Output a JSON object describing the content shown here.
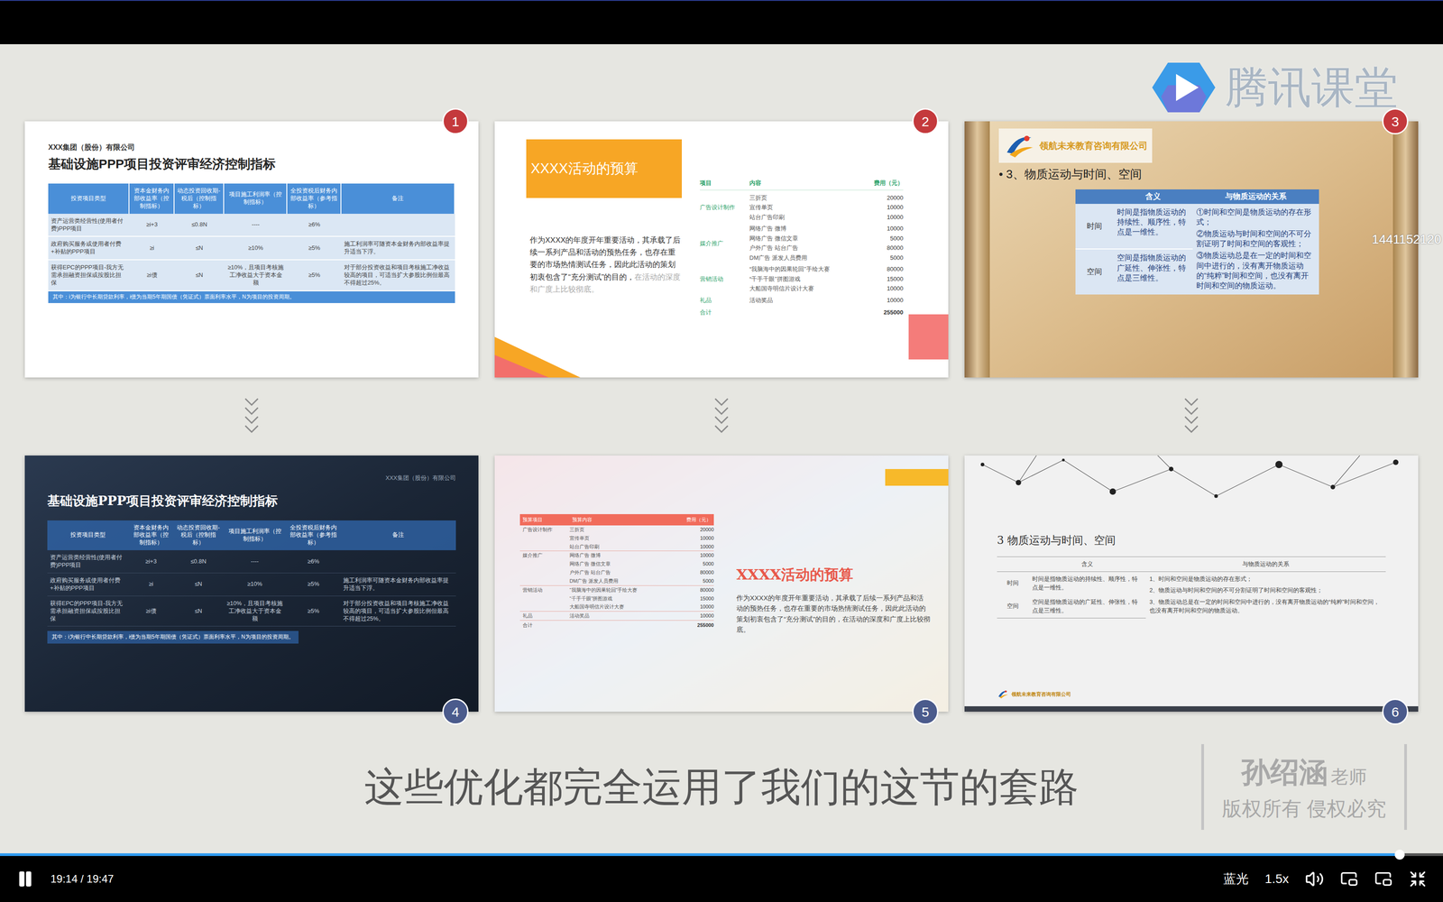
{
  "brand": {
    "name": "腾讯课堂"
  },
  "viewer_id": "1441152120",
  "ppp": {
    "company": "XXX集团（股份）有限公司",
    "title": "基础设施PPP项目投资评审经济控制指标",
    "columns": [
      "投资项目类型",
      "资本金财务内部收益率（控制指标）",
      "动态投资回收期-税后（控制指标）",
      "项目施工利润率（控制指标）",
      "全投资税后财务内部收益率（参考指标）",
      "备注"
    ],
    "rows": [
      [
        "资产运营类经营性(使用者付费)PPP项目",
        "≥i+3",
        "≤0.8N",
        "----",
        "≥6%",
        ""
      ],
      [
        "政府购买服务或使用者付费+补贴的PPP项目",
        "≥i",
        "≤N",
        "≥10%",
        "≥5%",
        "施工利润率可随资本金财务内部收益率提升适当下浮。"
      ],
      [
        "获得EPC的PPP项目-我方无需承担融资担保或按股比担保",
        "≥i债",
        "≤N",
        "≥10%，且项目考核施工净收益大于资本金额",
        "≥5%",
        "对于部分投资收益和项目考核施工净收益较高的项目，可适当扩大参股比例但最高不得超过25%。"
      ]
    ],
    "note": "其中：i为银行中长期贷款利率，i债为当期5年期国债（凭证式）票面利率水平，N为项目的投资周期。"
  },
  "budget": {
    "title": "XXXX活动的预算",
    "intro": "作为XXXX的年度开年重要活动，其承载了后续一系列产品和活动的预热任务，也存在重要的市场热情测试任务，因此此活动的策划初衷包含了“充分测试”的目的，",
    "intro_muted": "在活动的深度和广度上比较彻底。",
    "groups": [
      {
        "category": "广告设计制作",
        "items": [
          {
            "content": "三折页",
            "cost": "20000"
          },
          {
            "content": "宣传单页",
            "cost": "10000"
          },
          {
            "content": "站台广告印刷",
            "cost": "10000"
          }
        ]
      },
      {
        "category": "媒介推广",
        "items": [
          {
            "content": "网络广告 微博",
            "cost": "10000"
          },
          {
            "content": "网络广告 微信文章",
            "cost": "5000"
          },
          {
            "content": "户外广告 站台广告",
            "cost": "80000"
          },
          {
            "content": "DM广告 派发人员费用",
            "cost": "5000"
          }
        ]
      },
      {
        "category": "营销活动",
        "items": [
          {
            "content": "“我脑海中的因果轮回”手绘大赛",
            "cost": "80000"
          },
          {
            "content": "“千手千眼”拼图游戏",
            "cost": "15000"
          },
          {
            "content": "大船国寺明信片设计大赛",
            "cost": "10000"
          }
        ]
      },
      {
        "category": "礼品",
        "items": [
          {
            "content": "活动奖品",
            "cost": "10000"
          }
        ]
      }
    ],
    "total_label": "合计",
    "total": "255000"
  },
  "motion": {
    "logo": "领航未来教育咨询有限公司",
    "columns": [
      "含义",
      "与物质运动的关系"
    ],
    "rows": [
      {
        "label": "时间",
        "meaning": "时间是指物质运动的持续性、顺序性，特点是一维性。"
      },
      {
        "label": "空间",
        "meaning": "空间是指物质运动的广延性、伸张性，特点是三维性。"
      }
    ]
  },
  "thumbnails": [
    {
      "badge": "1",
      "color": "#c4393c",
      "kind": "ppp-light",
      "title": "",
      "columns": [],
      "relations": []
    },
    {
      "badge": "2",
      "color": "#c4393c",
      "kind": "budget-light",
      "title": "",
      "columns": [
        "项目",
        "内容",
        "费用（元）"
      ],
      "relations": []
    },
    {
      "badge": "3",
      "color": "#c4393c",
      "kind": "motion-scroll",
      "title": "• 3、物质运动与时间、空间",
      "columns": [],
      "relations": [
        "①时间和空间是物质运动的存在形式；",
        "②物质运动与时间和空间的不可分割证明了时间和空间的客观性；",
        "③物质运动总是在一定的时间和空间中进行的，没有离开物质运动的“纯粹”时间和空间，也没有离开时间和空间的物质运动。"
      ]
    },
    {
      "badge": "4",
      "color": "#4b5b8c",
      "kind": "ppp-dark",
      "title": "",
      "columns": [],
      "relations": []
    },
    {
      "badge": "5",
      "color": "#4b5b8c",
      "kind": "budget-photo",
      "title": "",
      "columns": [
        "预算项目",
        "预算内容",
        "费用（元）"
      ],
      "relations": []
    },
    {
      "badge": "6",
      "color": "#4b5b8c",
      "kind": "motion-clean",
      "title": "3 物质运动与时间、空间",
      "columns": [],
      "relations": [
        "1、时间和空间是物质运动的存在形式；",
        "2、物质运动与时间和空间的不可分割证明了时间和空间的客观性；",
        "3、物质运动总是在一定的时间和空间中进行的，没有离开物质运动的“纯粹”时间和空间，也没有离开时间和空间的物质运动。"
      ]
    }
  ],
  "subtitle": "这些优化都完全运用了我们的这节的套路",
  "copyright": {
    "teacher": "孙绍涵",
    "role": "老师",
    "notice": "版权所有 侵权必究"
  },
  "player": {
    "playing": true,
    "progress": 0.97,
    "time": "19:14 / 19:47",
    "quality": "蓝光",
    "speed": "1.5x"
  }
}
